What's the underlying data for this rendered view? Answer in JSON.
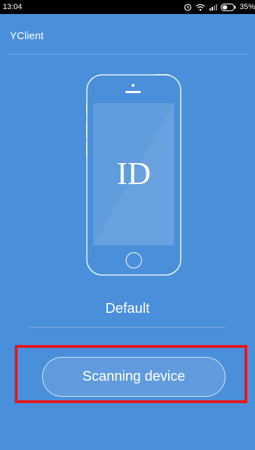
{
  "status_bar": {
    "time": "13:04",
    "battery": "35%",
    "icons": [
      "alarm-icon",
      "wifi-icon",
      "signal-icon",
      "battery-icon"
    ]
  },
  "app": {
    "title": "YClient"
  },
  "device": {
    "illustration_label": "ID",
    "name": "Default"
  },
  "actions": {
    "scan_label": "Scanning device"
  },
  "colors": {
    "background": "#4a8fd9",
    "highlight": "#e5171f"
  }
}
